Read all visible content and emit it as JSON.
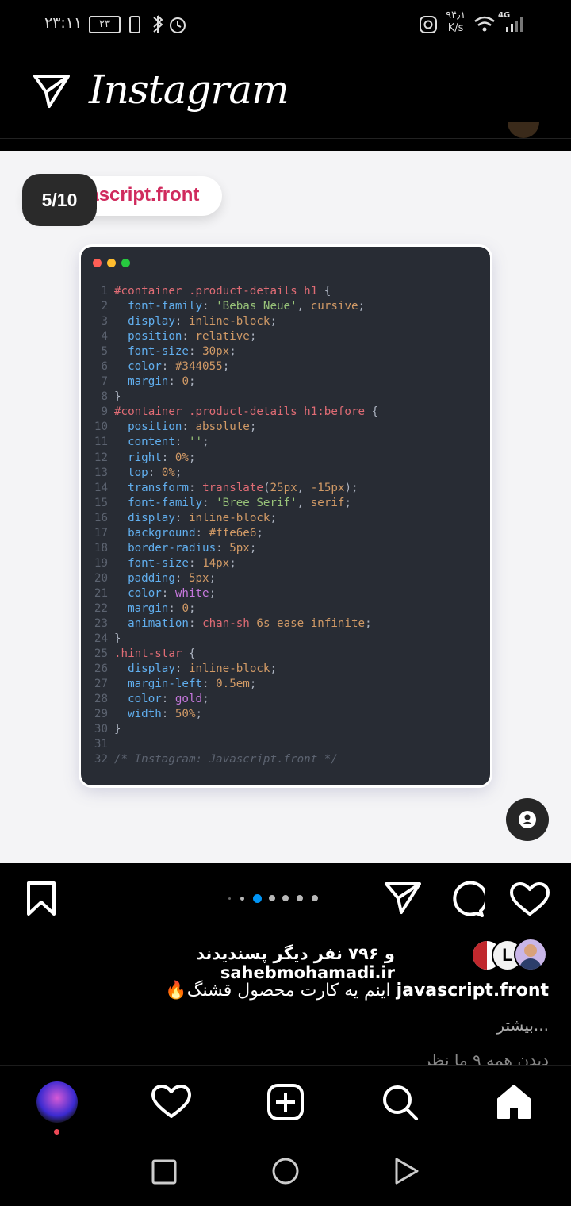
{
  "status_bar": {
    "time": "۲۳:۱۱",
    "battery": "۲۳",
    "net_speed_value": "۹۴٫۱",
    "net_speed_unit": "K/s",
    "network": "4G"
  },
  "header": {
    "title": "Instagram"
  },
  "post": {
    "counter": "5/10",
    "brand": "javascript.front",
    "brand_visible": "vascript.front",
    "code_lines": [
      [
        [
          "sel",
          "#container .product-details h1"
        ],
        [
          "pl",
          " {"
        ]
      ],
      [
        [
          "prop",
          "  font-family"
        ],
        [
          "pl",
          ": "
        ],
        [
          "str",
          "'Bebas Neue'"
        ],
        [
          "pl",
          ", "
        ],
        [
          "val",
          "cursive"
        ],
        [
          "pl",
          ";"
        ]
      ],
      [
        [
          "prop",
          "  display"
        ],
        [
          "pl",
          ": "
        ],
        [
          "val",
          "inline-block"
        ],
        [
          "pl",
          ";"
        ]
      ],
      [
        [
          "prop",
          "  position"
        ],
        [
          "pl",
          ": "
        ],
        [
          "val",
          "relative"
        ],
        [
          "pl",
          ";"
        ]
      ],
      [
        [
          "prop",
          "  font-size"
        ],
        [
          "pl",
          ": "
        ],
        [
          "val",
          "30px"
        ],
        [
          "pl",
          ";"
        ]
      ],
      [
        [
          "prop",
          "  color"
        ],
        [
          "pl",
          ": "
        ],
        [
          "val",
          "#344055"
        ],
        [
          "pl",
          ";"
        ]
      ],
      [
        [
          "prop",
          "  margin"
        ],
        [
          "pl",
          ": "
        ],
        [
          "val",
          "0"
        ],
        [
          "pl",
          ";"
        ]
      ],
      [
        [
          "pl",
          "}"
        ]
      ],
      [
        [
          "sel",
          "#container .product-details h1:before"
        ],
        [
          "pl",
          " {"
        ]
      ],
      [
        [
          "prop",
          "  position"
        ],
        [
          "pl",
          ": "
        ],
        [
          "val",
          "absolute"
        ],
        [
          "pl",
          ";"
        ]
      ],
      [
        [
          "prop",
          "  content"
        ],
        [
          "pl",
          ": "
        ],
        [
          "str",
          "''"
        ],
        [
          "pl",
          ";"
        ]
      ],
      [
        [
          "prop",
          "  right"
        ],
        [
          "pl",
          ": "
        ],
        [
          "val",
          "0%"
        ],
        [
          "pl",
          ";"
        ]
      ],
      [
        [
          "prop",
          "  top"
        ],
        [
          "pl",
          ": "
        ],
        [
          "val",
          "0%"
        ],
        [
          "pl",
          ";"
        ]
      ],
      [
        [
          "prop",
          "  transform"
        ],
        [
          "pl",
          ": "
        ],
        [
          "sel",
          "translate"
        ],
        [
          "pl",
          "("
        ],
        [
          "val",
          "25px"
        ],
        [
          "pl",
          ", "
        ],
        [
          "val",
          "-15px"
        ],
        [
          "pl",
          ");"
        ]
      ],
      [
        [
          "prop",
          "  font-family"
        ],
        [
          "pl",
          ": "
        ],
        [
          "str",
          "'Bree Serif'"
        ],
        [
          "pl",
          ", "
        ],
        [
          "val",
          "serif"
        ],
        [
          "pl",
          ";"
        ]
      ],
      [
        [
          "prop",
          "  display"
        ],
        [
          "pl",
          ": "
        ],
        [
          "val",
          "inline-block"
        ],
        [
          "pl",
          ";"
        ]
      ],
      [
        [
          "prop",
          "  background"
        ],
        [
          "pl",
          ": "
        ],
        [
          "val",
          "#ffe6e6"
        ],
        [
          "pl",
          ";"
        ]
      ],
      [
        [
          "prop",
          "  border-radius"
        ],
        [
          "pl",
          ": "
        ],
        [
          "val",
          "5px"
        ],
        [
          "pl",
          ";"
        ]
      ],
      [
        [
          "prop",
          "  font-size"
        ],
        [
          "pl",
          ": "
        ],
        [
          "val",
          "14px"
        ],
        [
          "pl",
          ";"
        ]
      ],
      [
        [
          "prop",
          "  padding"
        ],
        [
          "pl",
          ": "
        ],
        [
          "val",
          "5px"
        ],
        [
          "pl",
          ";"
        ]
      ],
      [
        [
          "prop",
          "  color"
        ],
        [
          "pl",
          ": "
        ],
        [
          "kw",
          "white"
        ],
        [
          "pl",
          ";"
        ]
      ],
      [
        [
          "prop",
          "  margin"
        ],
        [
          "pl",
          ": "
        ],
        [
          "val",
          "0"
        ],
        [
          "pl",
          ";"
        ]
      ],
      [
        [
          "prop",
          "  animation"
        ],
        [
          "pl",
          ": "
        ],
        [
          "sel",
          "chan-sh"
        ],
        [
          "pl",
          " "
        ],
        [
          "val",
          "6s ease infinite"
        ],
        [
          "pl",
          ";"
        ]
      ],
      [
        [
          "pl",
          "}"
        ]
      ],
      [
        [
          "sel",
          ".hint-star"
        ],
        [
          "pl",
          " {"
        ]
      ],
      [
        [
          "prop",
          "  display"
        ],
        [
          "pl",
          ": "
        ],
        [
          "val",
          "inline-block"
        ],
        [
          "pl",
          ";"
        ]
      ],
      [
        [
          "prop",
          "  margin-left"
        ],
        [
          "pl",
          ": "
        ],
        [
          "val",
          "0.5em"
        ],
        [
          "pl",
          ";"
        ]
      ],
      [
        [
          "prop",
          "  color"
        ],
        [
          "pl",
          ": "
        ],
        [
          "kw",
          "gold"
        ],
        [
          "pl",
          ";"
        ]
      ],
      [
        [
          "prop",
          "  width"
        ],
        [
          "pl",
          ": "
        ],
        [
          "val",
          "50%"
        ],
        [
          "pl",
          ";"
        ]
      ],
      [
        [
          "pl",
          "}"
        ]
      ],
      [
        [
          "pl",
          ""
        ]
      ],
      [
        [
          "cm",
          "/* Instagram: Javascript.front */"
        ]
      ]
    ]
  },
  "engagement": {
    "likes_prefix": "و ۷۹۶ نفر دیگر پسندیدند",
    "likes_user": "sahebmohamadi.ir",
    "caption_user": "javascript.front",
    "caption_text": "اینم یه کارت محصول قشنگ🔥",
    "more": "...بیشتر",
    "comments_peek": "دیدن همه ۹ ما نظر"
  },
  "colors": {
    "accent": "#0095f6",
    "brand_pink": "#d02a5d",
    "notification": "#ed4956"
  }
}
